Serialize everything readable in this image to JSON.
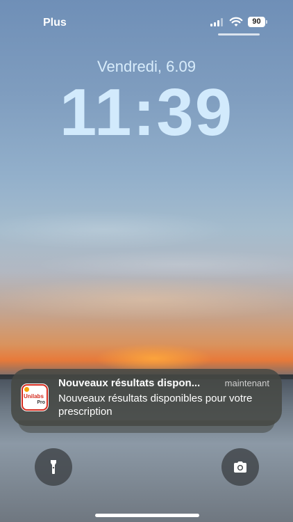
{
  "status_bar": {
    "carrier": "Plus",
    "battery_level": "90",
    "signal_icon": "cellular-signal-icon",
    "wifi_icon": "wifi-icon"
  },
  "lock_screen": {
    "date": "Vendredi, 6.09",
    "time": "11:39"
  },
  "notification": {
    "app_icon": "unilabs-pro-app-icon",
    "app_icon_text": "Unilabs",
    "app_icon_subtext": "Pro",
    "title": "Nouveaux résultats dispon...",
    "timestamp": "maintenant",
    "body": "Nouveaux résultats disponibles pour votre prescription"
  },
  "quick_actions": {
    "flashlight_icon": "flashlight-icon",
    "camera_icon": "camera-icon"
  },
  "colors": {
    "clock": "#d2eafc",
    "notification_bg": "#464844",
    "brand_red": "#d42a1d"
  }
}
